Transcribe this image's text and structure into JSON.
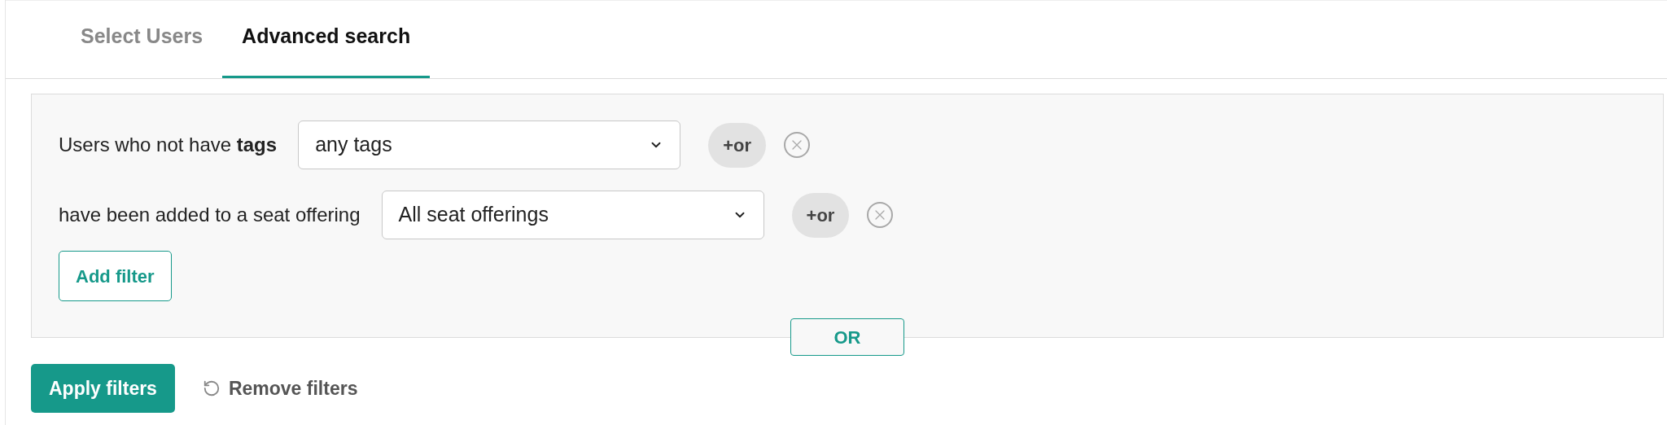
{
  "tabs": [
    {
      "label": "Select Users",
      "selected": false
    },
    {
      "label": "Advanced search",
      "selected": true
    }
  ],
  "filters": [
    {
      "label": "Users who not have **tags**",
      "value": "any tags",
      "or_button": "+or"
    },
    {
      "label": "have been added to a seat offering",
      "value": "All seat offerings",
      "or_button": "+or"
    }
  ],
  "add_filter": "Add filter",
  "or_connector": "OR",
  "apply_button": "Apply filters",
  "remove_button": "Remove filters"
}
